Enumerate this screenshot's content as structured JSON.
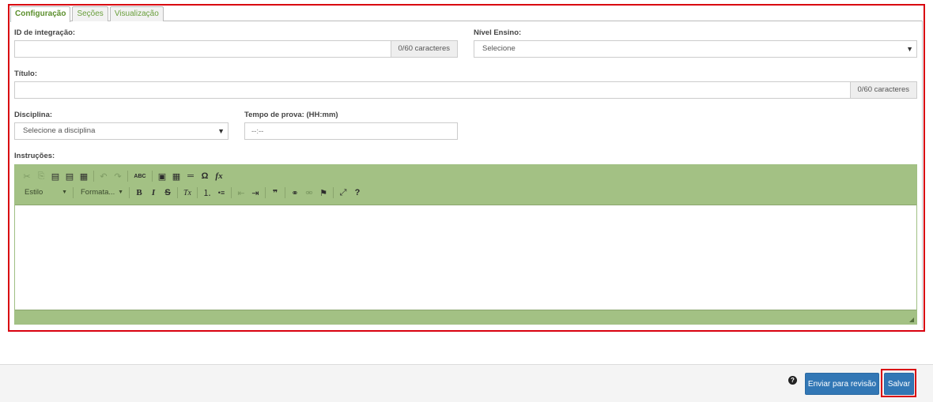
{
  "tabs": [
    {
      "label": "Configuração",
      "active": true
    },
    {
      "label": "Seções",
      "active": false
    },
    {
      "label": "Visualização",
      "active": false
    }
  ],
  "form": {
    "integration_id": {
      "label": "ID de integração:",
      "value": "",
      "counter": "0/60 caracteres"
    },
    "education_level": {
      "label": "Nível Ensino:",
      "selected": "Selecione"
    },
    "title": {
      "label": "Título:",
      "value": "",
      "counter": "0/60 caracteres"
    },
    "subject": {
      "label": "Disciplina:",
      "selected": "Selecione a disciplina"
    },
    "exam_time": {
      "label": "Tempo de prova: (HH:mm)",
      "placeholder": "--:--"
    },
    "instructions": {
      "label": "Instruções:"
    }
  },
  "editor": {
    "style_combo": "Estilo",
    "format_combo": "Formata...",
    "toolbar_color": "#a3c184",
    "buttons": {
      "cut": "✂",
      "copy": "⎘",
      "paste": "📋",
      "paste_text": "▤",
      "paste_word": "▦",
      "undo": "↶",
      "redo": "↷",
      "spellcheck": "ABC",
      "image": "▣",
      "table": "▦",
      "hr": "═",
      "special_char": "Ω",
      "formula": "fx",
      "bold": "B",
      "italic": "I",
      "strike": "S",
      "remove_format": "Tx",
      "numbered_list": "⒈",
      "bulleted_list": "•≡",
      "outdent": "⇤",
      "indent": "⇥",
      "blockquote": "❞",
      "link": "⚭",
      "unlink": "⚮",
      "anchor": "⚑",
      "maximize": "⤢",
      "help": "?"
    }
  },
  "footer": {
    "help": "?",
    "send_review_label": "Enviar para revisão",
    "save_label": "Salvar",
    "button_color": "#3277b5"
  }
}
